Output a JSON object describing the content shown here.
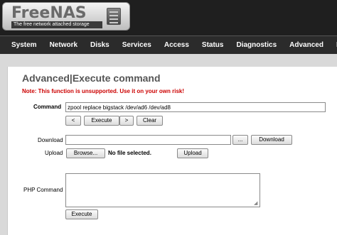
{
  "header": {
    "logo_text": "FreeNAS",
    "logo_tagline": "The free network attached storage"
  },
  "nav": [
    "System",
    "Network",
    "Disks",
    "Services",
    "Access",
    "Status",
    "Diagnostics",
    "Advanced",
    "Help"
  ],
  "page": {
    "title": "Advanced|Execute command",
    "warning": "Note: This function is unsupported. Use it on your own risk!"
  },
  "command": {
    "label": "Command",
    "value": "zpool replace bigstack /dev/ad6 /dev/ad8",
    "prev_label": "<",
    "execute_label": "Execute",
    "next_label": ">",
    "clear_label": "Clear"
  },
  "download": {
    "label": "Download",
    "value": "",
    "browse_label": "...",
    "button_label": "Download"
  },
  "upload": {
    "label": "Upload",
    "browse_label": "Browse...",
    "file_status": "No file selected.",
    "button_label": "Upload"
  },
  "php": {
    "label": "PHP Command",
    "value": "",
    "execute_label": "Execute"
  }
}
